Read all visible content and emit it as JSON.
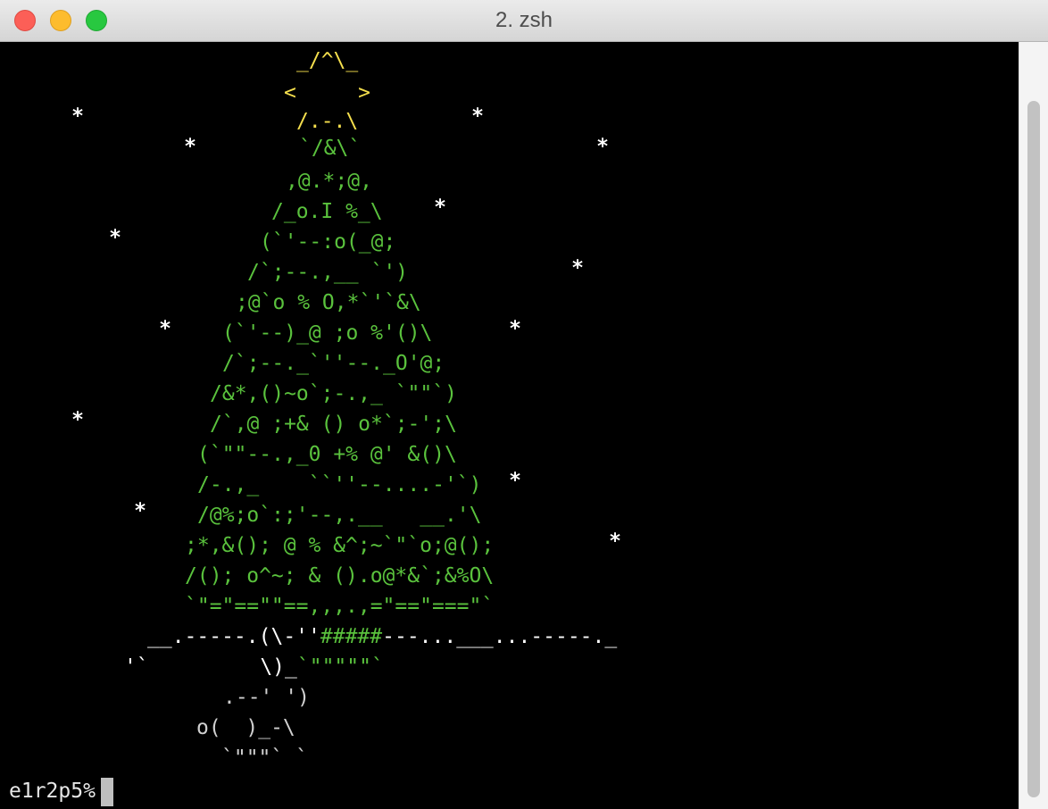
{
  "window": {
    "title": "2. zsh",
    "colors": {
      "star": "#f5df4d",
      "tree": "#5ac23d",
      "snow": "#ffffff",
      "background": "#000000"
    }
  },
  "tree": {
    "star": [
      "_/^\\_",
      "<     >",
      "/.-.\\"
    ],
    "body": [
      "`/&\\`",
      ",@.*;@,",
      "/_o.I %_\\",
      "(`'--:o(_@;",
      "/`;--.,__ `')",
      ";@`o % O,*`'`&\\",
      "(`'--)_@ ;o %'()\\",
      "/`;--._`''--._O'@;",
      "/&*,()~o`;-.,_ `\"\"`)",
      "/`,@ ;+& () o*`;-';\\",
      "(`\"\"--.,_0 +% @' &()\\",
      "/-.,_    ``''--....-'`)",
      "/@%;o`:;'--,.__   __.'\\",
      ";*,&(); @ % &^;~`\"`o;@();",
      "/(); o^~; & ().o@*&`;&%O\\",
      "`\"=\"==\"\"==,,,.,=\"==\"===\"`"
    ],
    "base_white_a": "__.-----.(\\-''",
    "base_green": "#####",
    "base_white_b": "---...___...-----._",
    "trunk_a_white": "'`         \\)_",
    "trunk_a_green": "`\"\"\"\"\"`",
    "trunk_b": ".--' ')",
    "trunk_c": "o(  )_-\\",
    "trunk_d": "`\"\"\"` `"
  },
  "snow": "*",
  "prompt": {
    "text": "e1r2p5%"
  }
}
